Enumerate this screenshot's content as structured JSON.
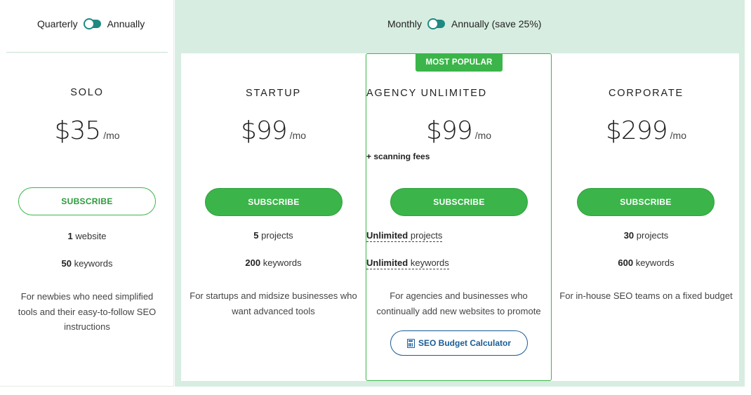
{
  "toggles": {
    "left": {
      "option_a": "Quarterly",
      "option_b": "Annually"
    },
    "right": {
      "option_a": "Monthly",
      "option_b": "Annually (save 25%)"
    }
  },
  "plans": [
    {
      "name": "SOLO",
      "price": "$35",
      "period": "/mo",
      "fees": "",
      "button": "SUBSCRIBE",
      "feature1_value": "1",
      "feature1_label": "website",
      "feature2_value": "50",
      "feature2_label": "keywords",
      "description_lines": [
        "For newbies who need simplified",
        "tools and their easy-to-follow SEO",
        "instructions"
      ]
    },
    {
      "name": "STARTUP",
      "price": "$99",
      "period": "/mo",
      "fees": "",
      "button": "SUBSCRIBE",
      "feature1_value": "5",
      "feature1_label": "projects",
      "feature2_value": "200",
      "feature2_label": "keywords",
      "description_lines": [
        "For startups and midsize businesses who",
        "want advanced tools"
      ]
    },
    {
      "name": "AGENCY UNLIMITED",
      "price": "$99",
      "period": "/mo",
      "fees": "+ scanning fees",
      "badge": "MOST POPULAR",
      "button": "SUBSCRIBE",
      "feature1_value": "Unlimited",
      "feature1_label": "projects",
      "feature2_value": "Unlimited",
      "feature2_label": "keywords",
      "description_lines": [
        "For agencies and businesses who",
        "continually add new websites to promote"
      ],
      "calculator_button": "SEO Budget Calculator"
    },
    {
      "name": "CORPORATE",
      "price": "$299",
      "period": "/mo",
      "fees": "",
      "button": "SUBSCRIBE",
      "feature1_value": "30",
      "feature1_label": "projects",
      "feature2_value": "600",
      "feature2_label": "keywords",
      "description_lines": [
        "For in-house SEO teams on a fixed budget"
      ]
    }
  ],
  "colors": {
    "accent_green": "#3bb54a",
    "background_green": "#d7ede1",
    "toggle_teal": "#1f8a82",
    "link_blue": "#1a5c96"
  },
  "icons": {
    "calculator": "calculator-icon"
  }
}
